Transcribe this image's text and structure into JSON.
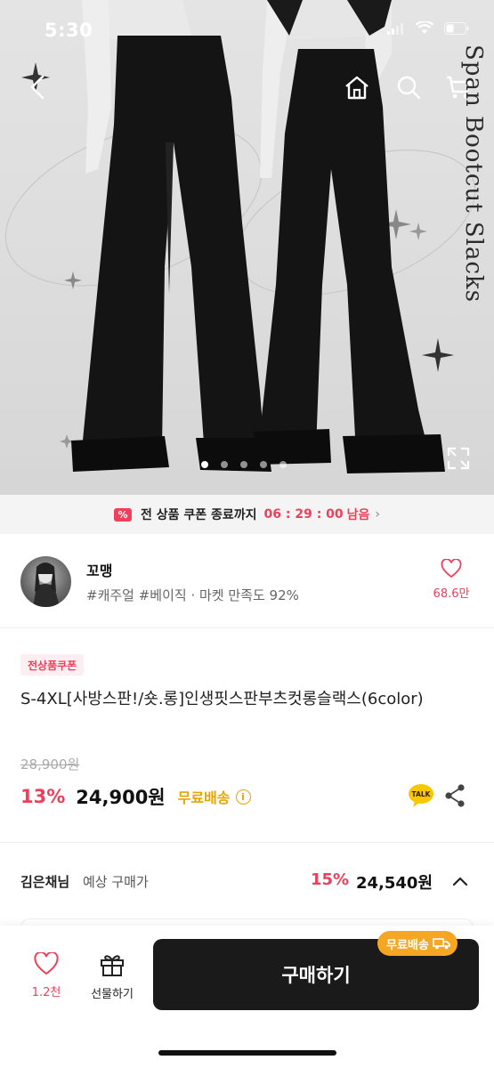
{
  "status": {
    "time": "5:30"
  },
  "hero": {
    "side_title": "Span Bootcut Slacks",
    "slide_count": 5,
    "active_slide": 1
  },
  "coupon_banner": {
    "icon_text": "%",
    "text": "전 상품 쿠폰 종료까지",
    "timer": "06 : 29 : 00",
    "suffix": "남음"
  },
  "shop": {
    "name": "꼬맹",
    "tags": "#캐주얼 #베이직 · 마켓 만족도 92%",
    "like_count": "68.6만"
  },
  "product": {
    "badge": "전상품쿠폰",
    "title": "S-4XL[사방스판!/숏.롱]인생핏스판부츠컷롱슬랙스(6color)",
    "original_price": "28,900원",
    "discount": "13%",
    "price": "24,900원",
    "shipping": "무료배송",
    "info_icon": "i",
    "talk_label": "TALK"
  },
  "expected": {
    "user_name": "김은채님",
    "label": "예상 구매가",
    "discount": "15%",
    "price": "24,540원"
  },
  "bottom_bar": {
    "like_count": "1.2천",
    "gift_label": "선물하기",
    "buy_label": "구매하기",
    "ship_pill": "무료배송"
  },
  "colors": {
    "accent": "#ef3f5a",
    "shipping": "#e8a400",
    "buy_button": "#1a1a1a"
  }
}
